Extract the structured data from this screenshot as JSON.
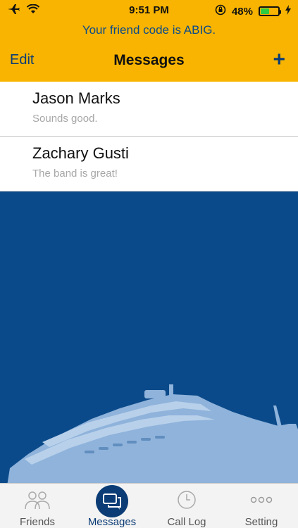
{
  "status_bar": {
    "time": "9:51 PM",
    "battery_percent": "48%"
  },
  "banner": {
    "text": "Your friend code is ABIG."
  },
  "nav": {
    "edit_label": "Edit",
    "title": "Messages",
    "add_label": "+"
  },
  "messages": [
    {
      "name": "Jason Marks",
      "preview": "Sounds good."
    },
    {
      "name": "Zachary Gusti",
      "preview": "The band is great!"
    }
  ],
  "tabs": [
    {
      "label": "Friends",
      "icon": "friends-icon"
    },
    {
      "label": "Messages",
      "icon": "messages-icon",
      "active": true
    },
    {
      "label": "Call Log",
      "icon": "clock-icon"
    },
    {
      "label": "Setting",
      "icon": "ellipsis-icon"
    }
  ],
  "colors": {
    "header": "#f8b400",
    "navy": "#0b4a8a",
    "ship": "#8fb3db"
  }
}
